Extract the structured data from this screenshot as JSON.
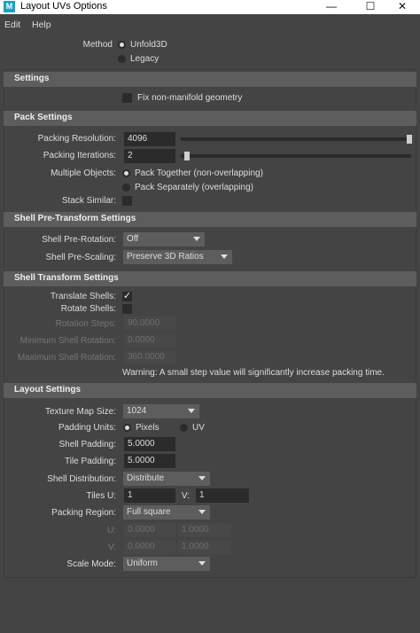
{
  "window": {
    "title": "Layout UVs Options",
    "app_icon": "M",
    "minimize": "—",
    "maximize": "☐",
    "close": "✕"
  },
  "menu": [
    "Edit",
    "Help"
  ],
  "method": {
    "label": "Method",
    "options": [
      "Unfold3D",
      "Legacy"
    ],
    "selected": 0
  },
  "settings": {
    "header": "Settings",
    "fix_nonmanifold": {
      "label": "Fix non-manifold geometry",
      "checked": false
    }
  },
  "pack": {
    "header": "Pack Settings",
    "resolution": {
      "label": "Packing Resolution:",
      "value": "4096",
      "slider_fraction": 1.0
    },
    "iterations": {
      "label": "Packing Iterations:",
      "value": "2",
      "slider_fraction": 0.0
    },
    "multiple_objects": {
      "label": "Multiple Objects:",
      "options": [
        "Pack Together (non-overlapping)",
        "Pack Separately (overlapping)"
      ],
      "selected": 0
    },
    "stack_similar": {
      "label": "Stack Similar:",
      "checked": false
    }
  },
  "shell_pre": {
    "header": "Shell Pre-Transform Settings",
    "rotation": {
      "label": "Shell Pre-Rotation:",
      "value": "Off"
    },
    "scaling": {
      "label": "Shell Pre-Scaling:",
      "value": "Preserve 3D Ratios"
    }
  },
  "shell_transform": {
    "header": "Shell Transform Settings",
    "translate": {
      "label": "Translate Shells:",
      "checked": true,
      "mark": "✓"
    },
    "rotate": {
      "label": "Rotate Shells:",
      "checked": false
    },
    "rotation_steps": {
      "label": "Rotation Steps:",
      "value": "90.0000"
    },
    "min_rotation": {
      "label": "Minimum Shell Rotation:",
      "value": "0.0000"
    },
    "max_rotation": {
      "label": "Maximum Shell Rotation:",
      "value": "360.0000"
    },
    "warning": "Warning: A small step value will significantly increase packing time."
  },
  "layout": {
    "header": "Layout Settings",
    "texture_map_size": {
      "label": "Texture Map Size:",
      "value": "1024"
    },
    "padding_units": {
      "label": "Padding Units:",
      "options": [
        "Pixels",
        "UV"
      ],
      "selected": 0
    },
    "shell_padding": {
      "label": "Shell Padding:",
      "value": "5.0000"
    },
    "tile_padding": {
      "label": "Tile Padding:",
      "value": "5.0000"
    },
    "shell_distribution": {
      "label": "Shell Distribution:",
      "value": "Distribute"
    },
    "tiles": {
      "u_label": "Tiles U:",
      "u_value": "1",
      "v_label": "V:",
      "v_value": "1"
    },
    "packing_region": {
      "label": "Packing Region:",
      "value": "Full square"
    },
    "region_u": {
      "label": "U:",
      "min": "0.0000",
      "max": "1.0000"
    },
    "region_v": {
      "label": "V:",
      "min": "0.0000",
      "max": "1.0000"
    },
    "scale_mode": {
      "label": "Scale Mode:",
      "value": "Uniform"
    }
  }
}
